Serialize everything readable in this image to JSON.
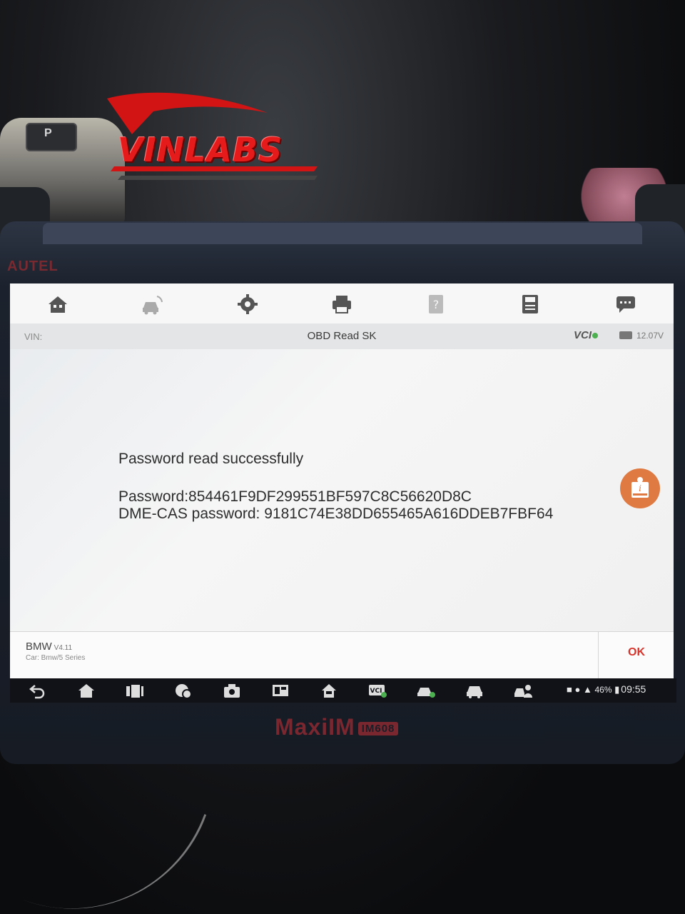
{
  "logo": {
    "text": "VINLABS"
  },
  "device": {
    "brand": "AUTEL",
    "model": "MaxiIM",
    "model_badge": "IM608"
  },
  "gear": {
    "letter": "P"
  },
  "toolbar": {
    "icons": [
      "home-icon",
      "vehicle-swap-icon",
      "settings-gear-icon",
      "print-icon",
      "help-icon",
      "save-icon",
      "feedback-chat-icon"
    ]
  },
  "subbar": {
    "vin_label": "VIN:",
    "title": "OBD Read SK",
    "vci_label": "VCI",
    "battery_voltage": "12.07V"
  },
  "content": {
    "line1": "Password read successfully",
    "line2": "Password:854461F9DF299551BF597C8C56620D8C",
    "line3": "DME-CAS password: 9181C74E38DD655465A616DDEB7FBF64"
  },
  "footer": {
    "manufacturer": "BMW",
    "version": "V4.11",
    "car": "Car: Bmw/5 Series",
    "ok_label": "OK"
  },
  "navbar": {
    "icons": [
      "back-icon",
      "home-icon",
      "recent-apps-icon",
      "browser-icon",
      "camera-icon",
      "display-icon",
      "remote-home-icon",
      "vci-manager-icon",
      "vehicle-check-icon",
      "car-icon",
      "user-support-icon"
    ],
    "battery_pct": "46%",
    "time": "09:55"
  },
  "colors": {
    "accent": "#e07a43",
    "ok": "#d8332b",
    "logo_red": "#e51b1b"
  }
}
